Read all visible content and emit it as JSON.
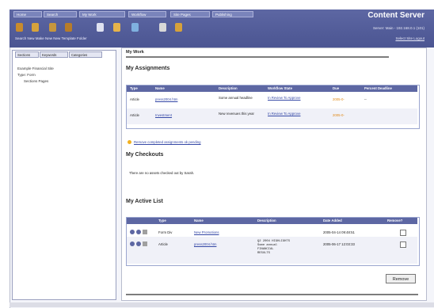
{
  "tabs": [
    "Home",
    "Search",
    "My Work",
    "Workflow",
    "Site Pages",
    "Publishing"
  ],
  "brand": "Content Server",
  "server_line": "Server: Main - 192.168.0.1 (101)",
  "top_links": "Select Site   Logout",
  "toolbar_labels": "Search New   Make New   New Template Folder",
  "toolbar_icons": [
    "search-icon",
    "new-icon",
    "folder-icon",
    "refresh-icon",
    "window-icon",
    "document-icon",
    "up-arrow-icon",
    "gear-icon",
    "key-icon"
  ],
  "left_tabs": [
    "Sections",
    "Keywords",
    "Categories"
  ],
  "tree": [
    "Example Financial Site",
    "Type: Form",
    "Sections Pages"
  ],
  "main": {
    "title": "My Work",
    "assignments_heading": "My Assignments",
    "assign_headers": [
      "Type",
      "Name",
      "Description",
      "Workflow State",
      "Due",
      "Percent Deadline"
    ],
    "assign_rows": [
      {
        "type": "Article",
        "name": "press2004.htm",
        "desc": "Some annual headline",
        "state": "In Review  To Approve",
        "due": "2005-0-",
        "pct": "--"
      },
      {
        "type": "Article",
        "name": "Investment",
        "desc": "New revenues this year",
        "state": "In Review  To Approve",
        "due": "2005-0-",
        "pct": ""
      }
    ],
    "remove_completed": "Remove completed assignments ok pending",
    "checkouts_heading": "My Checkouts",
    "checkouts_text": "There are no assets checked out by Sarah.",
    "active_heading": "My Active List",
    "active_headers": [
      "Type",
      "Name",
      "Description",
      "Date Added",
      "Remove?"
    ],
    "active_rows": [
      {
        "type": "Form Div",
        "name": "New Promotions",
        "desc": "",
        "date": "2005-04-14 09:48:51"
      },
      {
        "type": "Article",
        "name": "press2004.htm",
        "desc": "Q2 2004 HIGHLIGHTS\nSome annual\nFINANCIAL\nRESULTS",
        "date": "2005-06-17 12:03:33"
      }
    ],
    "remove_button": "Remove"
  },
  "colors": {
    "header": "#5d67a3",
    "link": "#3548a6",
    "due": "#e08a18"
  }
}
